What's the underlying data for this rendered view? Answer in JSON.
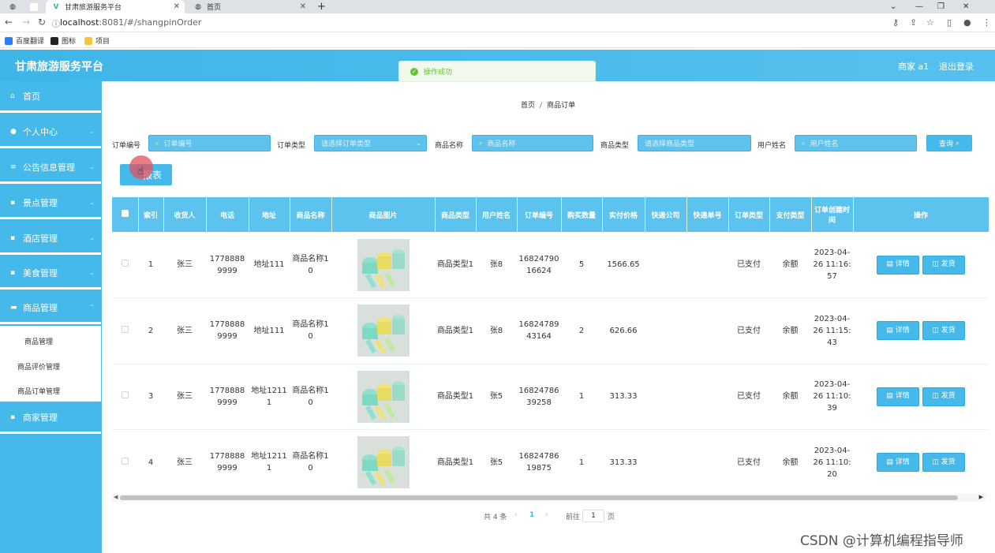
{
  "browser": {
    "tabs": [
      {
        "title": "甘肃旅游服务平台",
        "active": true
      },
      {
        "title": "首页",
        "active": false
      }
    ],
    "new_tab": "+",
    "url_host": "localhost",
    "url_path": ":8081/#/shangpinOrder",
    "bookmarks": [
      "百度翻译",
      "图标",
      "项目"
    ]
  },
  "header": {
    "title": "甘肃旅游服务平台",
    "user": "商家 a1",
    "logout": "退出登录"
  },
  "toast": {
    "text": "操作成功"
  },
  "sidebar": {
    "items": [
      {
        "label": "首页",
        "icon": "home-icon"
      },
      {
        "label": "个人中心",
        "icon": "user-icon"
      },
      {
        "label": "公告信息管理",
        "icon": "list-icon"
      },
      {
        "label": "景点管理",
        "icon": "grid-icon"
      },
      {
        "label": "酒店管理",
        "icon": "grid-icon"
      },
      {
        "label": "美食管理",
        "icon": "grid-icon"
      },
      {
        "label": "商品管理",
        "icon": "chat-icon"
      },
      {
        "label": "商家管理",
        "icon": "grid-icon"
      }
    ],
    "sub_items": [
      "商品管理",
      "商品评价管理",
      "商品订单管理"
    ]
  },
  "breadcrumb": {
    "home": "首页",
    "sep": "/",
    "current": "商品订单"
  },
  "filters": {
    "order_no_label": "订单编号",
    "order_no_placeholder": "订单编号",
    "order_type_label": "订单类型",
    "order_type_placeholder": "请选择订单类型",
    "product_name_label": "商品名称",
    "product_name_placeholder": "商品名称",
    "product_type_label": "商品类型",
    "product_type_placeholder": "请选择商品类型",
    "user_name_label": "用户姓名",
    "user_name_placeholder": "用户姓名",
    "search_button": "查询"
  },
  "report_button": "报表",
  "table": {
    "headers": [
      "",
      "索引",
      "收货人",
      "电话",
      "地址",
      "商品名称",
      "商品图片",
      "商品类型",
      "用户姓名",
      "订单编号",
      "购买数量",
      "实付价格",
      "快递公司",
      "快递单号",
      "订单类型",
      "支付类型",
      "订单创建时间",
      "操作"
    ],
    "rows": [
      {
        "index": "1",
        "receiver": "张三",
        "phone": "17788889999",
        "address": "地址111",
        "product_name": "商品名称10",
        "product_type": "商品类型1",
        "user_name": "张8",
        "order_no": "1682479016624",
        "quantity": "5",
        "price": "1566.65",
        "courier": "",
        "tracking_no": "",
        "order_type": "已支付",
        "pay_type": "余额",
        "created": "2023-04-26 11:16:57"
      },
      {
        "index": "2",
        "receiver": "张三",
        "phone": "17788889999",
        "address": "地址111",
        "product_name": "商品名称10",
        "product_type": "商品类型1",
        "user_name": "张8",
        "order_no": "1682478943164",
        "quantity": "2",
        "price": "626.66",
        "courier": "",
        "tracking_no": "",
        "order_type": "已支付",
        "pay_type": "余额",
        "created": "2023-04-26 11:15:43"
      },
      {
        "index": "3",
        "receiver": "张三",
        "phone": "17788889999",
        "address": "地址12111",
        "product_name": "商品名称10",
        "product_type": "商品类型1",
        "user_name": "张5",
        "order_no": "1682478639258",
        "quantity": "1",
        "price": "313.33",
        "courier": "",
        "tracking_no": "",
        "order_type": "已支付",
        "pay_type": "余额",
        "created": "2023-04-26 11:10:39"
      },
      {
        "index": "4",
        "receiver": "张三",
        "phone": "17788889999",
        "address": "地址12111",
        "product_name": "商品名称10",
        "product_type": "商品类型1",
        "user_name": "张5",
        "order_no": "1682478619875",
        "quantity": "1",
        "price": "313.33",
        "courier": "",
        "tracking_no": "",
        "order_type": "已支付",
        "pay_type": "余额",
        "created": "2023-04-26 11:10:20"
      }
    ],
    "detail_button": "详情",
    "ship_button": "发货"
  },
  "pagination": {
    "total": "共 4 条",
    "current": "1",
    "goto": "前往",
    "goto_value": "1",
    "page_suffix": "页"
  },
  "watermark": "CSDN @计算机编程指导师",
  "colors": {
    "accent": "#45b9ea",
    "header": "#3fb5e7",
    "success": "#67c23a"
  }
}
